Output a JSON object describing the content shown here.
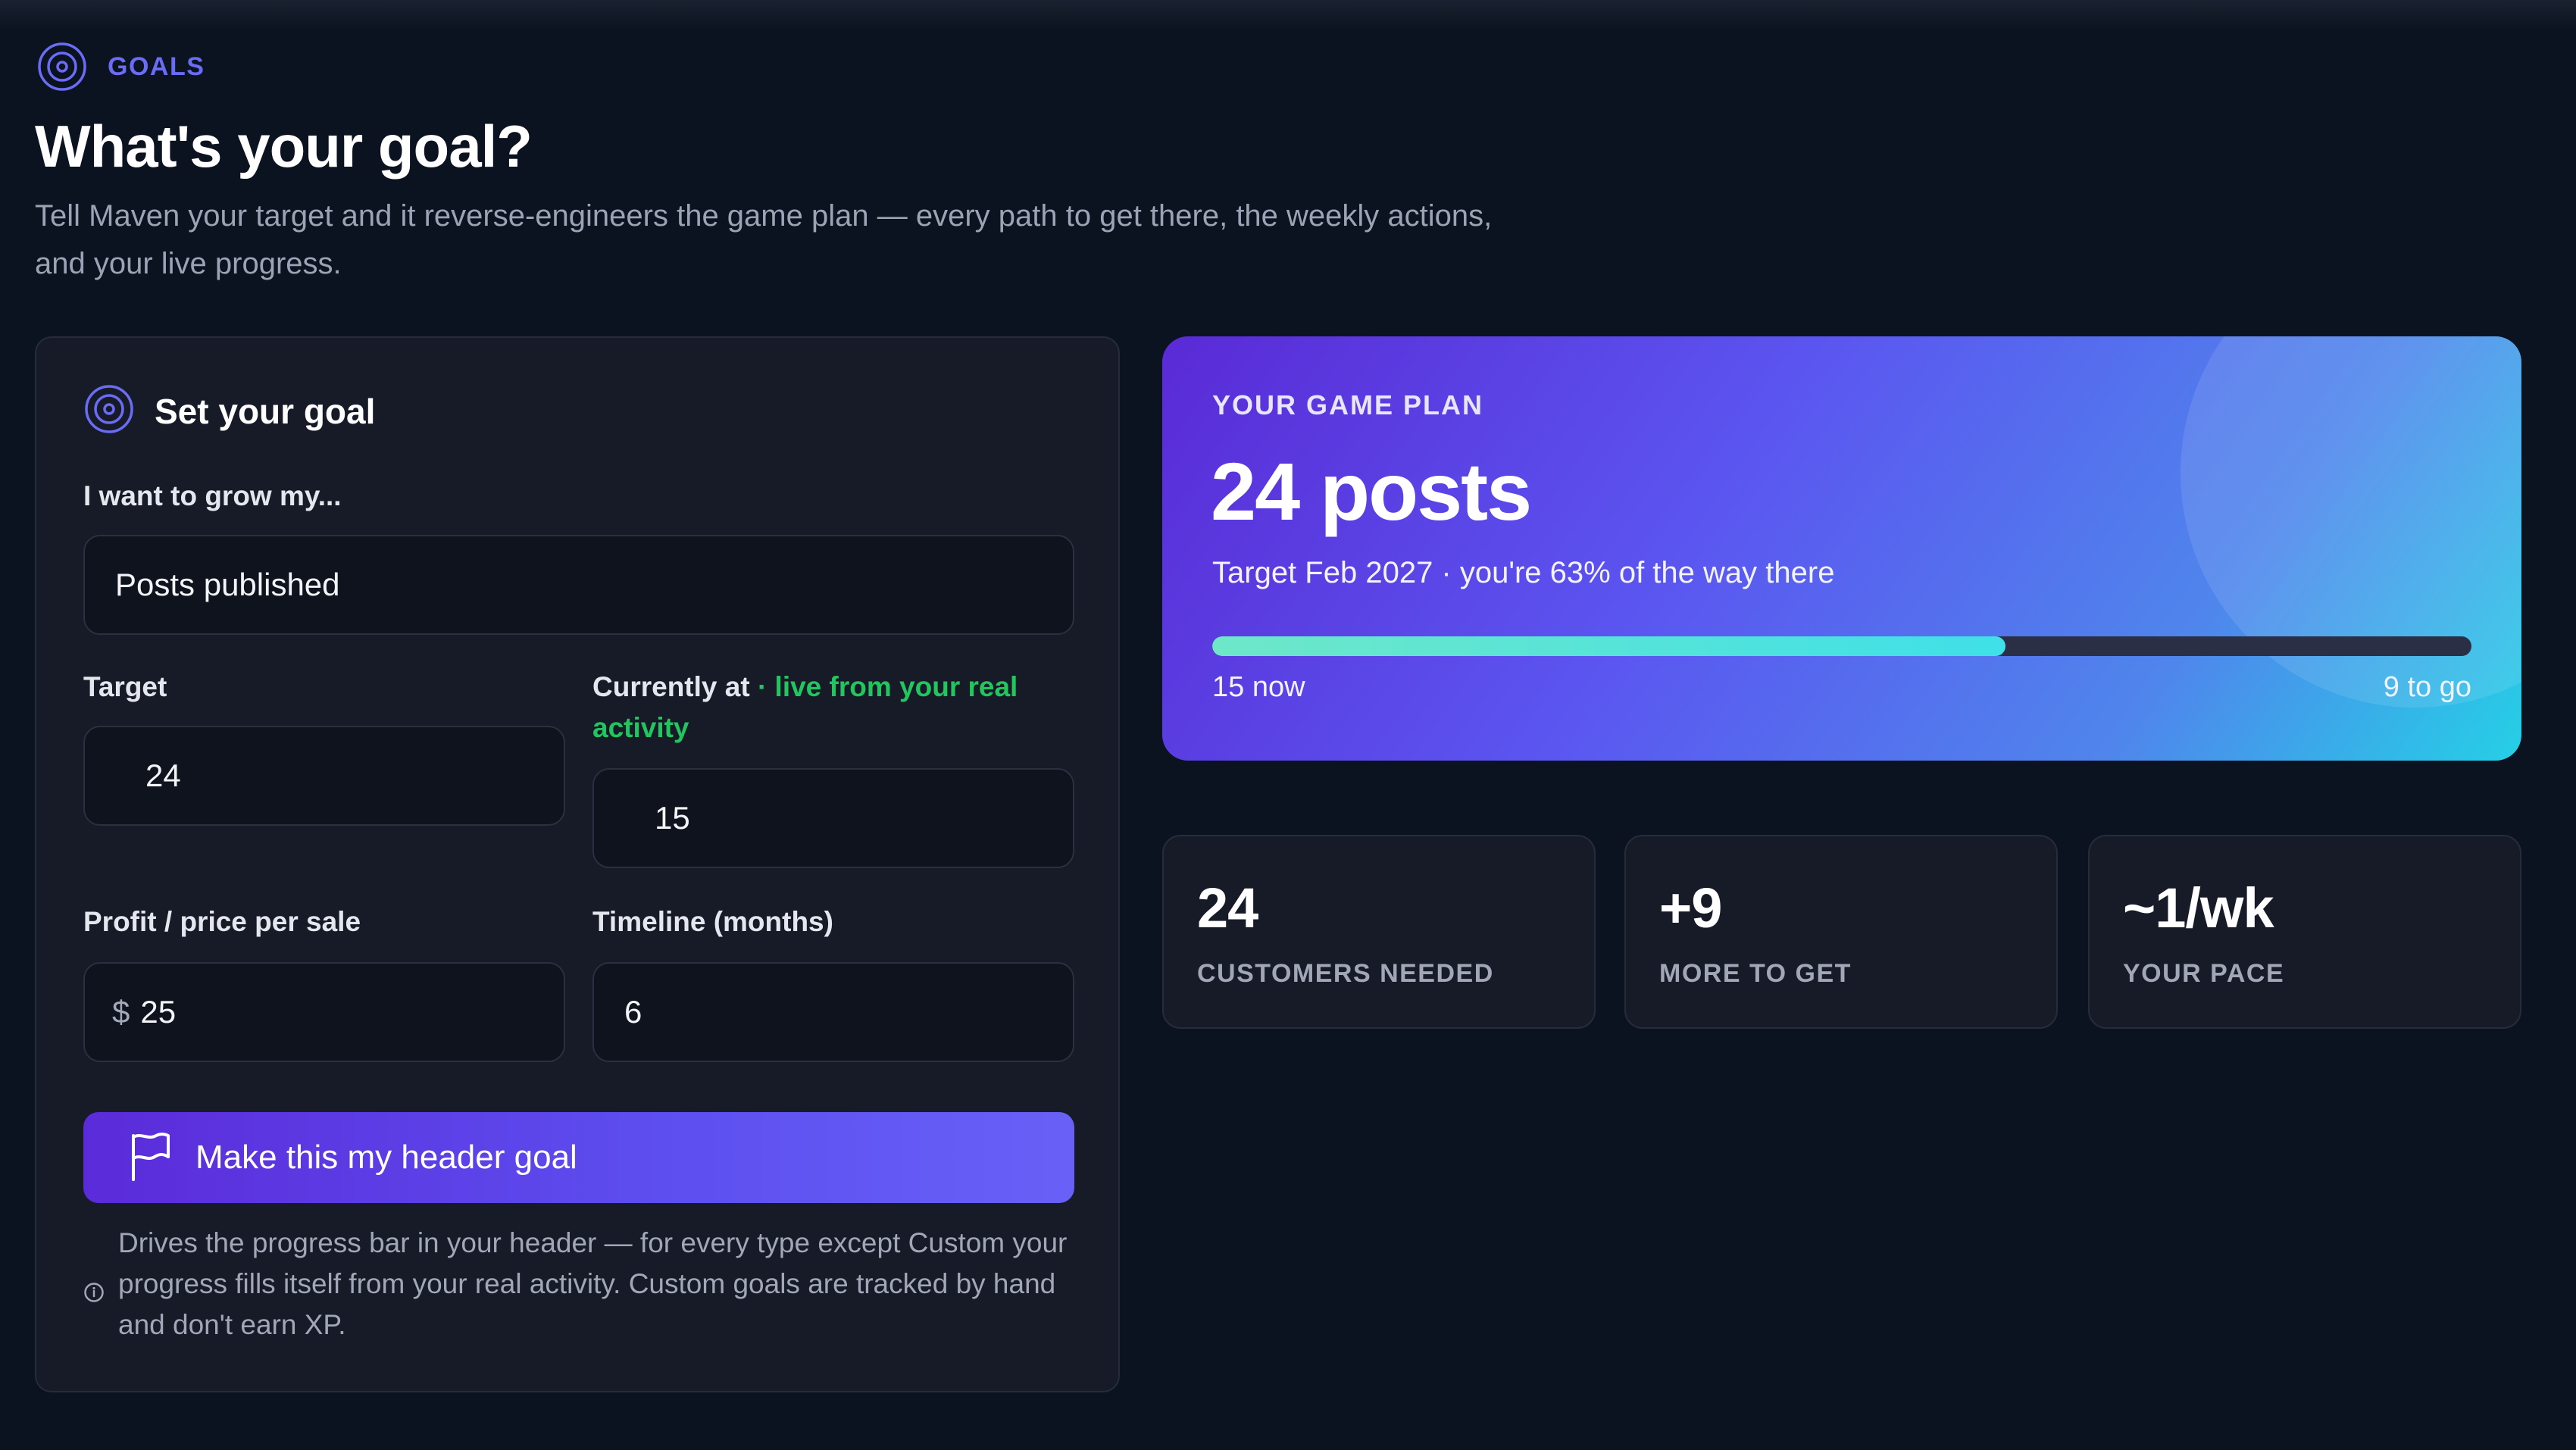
{
  "section": {
    "label": "GOALS",
    "icon": "target-icon"
  },
  "page": {
    "title": "What's your goal?",
    "subtitle": "Tell Maven your target and it reverse-engineers the game plan — every path to get there, the weekly actions, and your live progress."
  },
  "goal_form": {
    "title": "Set your goal",
    "grow_label": "I want to grow my...",
    "grow_value": "Posts published",
    "target_label": "Target",
    "target_value": "24",
    "current_label": "Currently at",
    "current_live_note": "· live from your real activity",
    "current_value": "15",
    "price_label": "Profit / price per sale",
    "price_prefix": "$",
    "price_value": "25",
    "timeline_label": "Timeline (months)",
    "timeline_value": "6",
    "cta_label": "Make this my header goal",
    "note": "Drives the progress bar in your header — for every type except Custom your progress fills itself from your real activity. Custom goals are tracked by hand and don't earn XP."
  },
  "game_plan": {
    "eyebrow": "YOUR GAME PLAN",
    "headline": "24 posts",
    "subtitle": "Target Feb 2027 · you're 63% of the way there",
    "progress_fraction": 0.63,
    "now_label": "15 now",
    "to_go_label": "9 to go"
  },
  "stats": [
    {
      "value": "24",
      "label": "CUSTOMERS NEEDED"
    },
    {
      "value": "+9",
      "label": "MORE TO GET"
    },
    {
      "value": "~1/wk",
      "label": "YOUR PACE"
    }
  ],
  "colors": {
    "background": "#0b1220",
    "accent": "#6a6cf4",
    "live_green": "#22c55e",
    "card": "#161b27"
  }
}
